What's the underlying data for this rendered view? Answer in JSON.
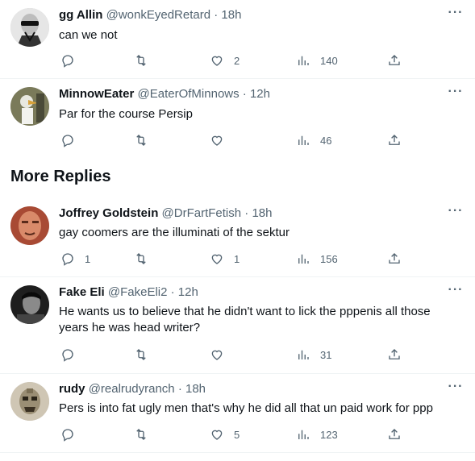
{
  "section_title": "More Replies",
  "more_glyph": "···",
  "tweets": [
    {
      "name": "gg Allin",
      "handle": "@wonkEyedRetard",
      "time": "· 18h",
      "text": "can we not",
      "replies": "",
      "retweets": "",
      "likes": "2",
      "views": "140",
      "avatar_color": "#d9d9d9"
    },
    {
      "name": "MinnowEater",
      "handle": "@EaterOfMinnows",
      "time": "· 12h",
      "text": "Par for the course Persip",
      "replies": "",
      "retweets": "",
      "likes": "",
      "views": "46",
      "avatar_color": "#6e6f55"
    },
    {
      "name": "Joffrey Goldstein",
      "handle": "@DrFartFetish",
      "time": "· 18h",
      "text": "gay coomers are the illuminati of the sektur",
      "replies": "1",
      "retweets": "",
      "likes": "1",
      "views": "156",
      "avatar_color": "#b5563e"
    },
    {
      "name": "Fake Eli",
      "handle": "@FakeEli2",
      "time": "· 12h",
      "text": "He wants us to believe that he didn't want to lick the pppenis all those years he was head writer?",
      "replies": "",
      "retweets": "",
      "likes": "",
      "views": "31",
      "avatar_color": "#2a2a2a"
    },
    {
      "name": "rudy",
      "handle": "@realrudyranch",
      "time": "· 18h",
      "text": "Pers is into fat ugly men that's why he did all that un paid work for ppp",
      "replies": "",
      "retweets": "",
      "likes": "5",
      "views": "123",
      "avatar_color": "#8a7f6a"
    }
  ]
}
